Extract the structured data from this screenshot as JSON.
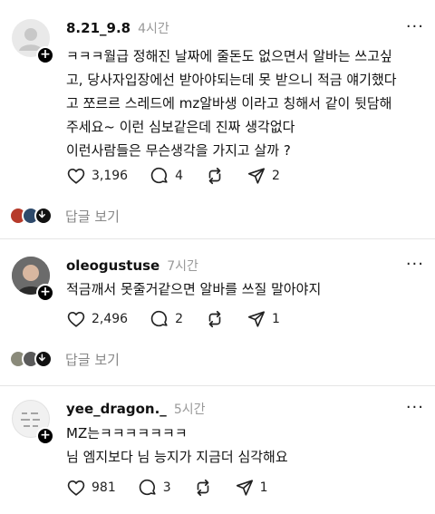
{
  "posts": [
    {
      "username": "8.21_9.8",
      "time": "4시간",
      "lines": [
        "ㅋㅋㅋ월급 정해진 날짜에 줄돈도 없으면서 알바는 쓰고싶",
        "고, 당사자입장에선 받아야되는데 못 받으니 적금 얘기했다",
        "고 쪼르르 스레드에 mz알바생 이라고 칭해서 같이 뒷담해",
        "주세요~ 이런 심보같은데 진짜 생각없다",
        "이런사람들은 무슨생각을 가지고 살까 ?"
      ],
      "likes": "3,196",
      "comments": "4",
      "shares": "2",
      "reply_label": "답글 보기"
    },
    {
      "username": "oleogustuse",
      "time": "7시간",
      "lines": [
        "적금깨서 못줄거같으면 알바를 쓰질 말아야지"
      ],
      "likes": "2,496",
      "comments": "2",
      "shares": "1",
      "reply_label": "답글 보기"
    },
    {
      "username": "yee_dragon._",
      "time": "5시간",
      "lines": [
        "MZ는ㅋㅋㅋㅋㅋㅋㅋ",
        "님 엠지보다 님 능지가 지금더 심각해요"
      ],
      "likes": "981",
      "comments": "3",
      "shares": "1"
    }
  ],
  "icons": {
    "like": "heart-icon",
    "comment": "comment-bubble-icon",
    "repost": "repost-icon",
    "share": "send-icon",
    "more": "more-dots-icon",
    "follow": "plus-icon"
  },
  "more_glyph": "···",
  "plus_glyph": "+"
}
